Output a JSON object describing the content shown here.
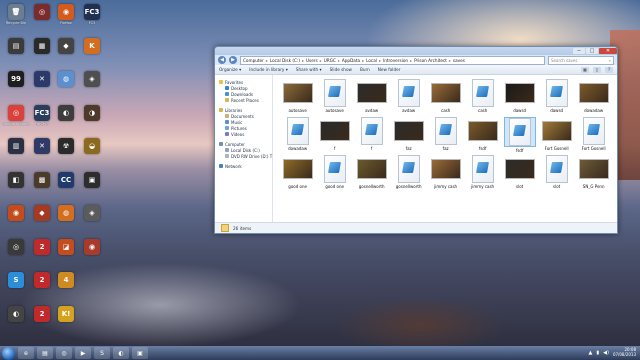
{
  "desktop": {
    "icons": [
      {
        "label": "Recycle Bin",
        "symbol": "🗑",
        "color": "#6a7d91"
      },
      {
        "label": "",
        "symbol": "◎",
        "color": "#7b2b2b"
      },
      {
        "label": "Firefox",
        "symbol": "◉",
        "color": "#d35b1d"
      },
      {
        "label": "FC3",
        "symbol": "FC3",
        "color": "#1f3050"
      },
      {
        "label": "",
        "symbol": "▤",
        "color": "#3b3b3b"
      },
      {
        "label": "",
        "symbol": "▦",
        "color": "#2a2a2a"
      },
      {
        "label": "",
        "symbol": "◆",
        "color": "#444"
      },
      {
        "label": "",
        "symbol": "K",
        "color": "#d36d1f"
      },
      {
        "label": "",
        "symbol": "99",
        "color": "#1e1e1e"
      },
      {
        "label": "",
        "symbol": "✕",
        "color": "#2c3a6b"
      },
      {
        "label": "",
        "symbol": "◍",
        "color": "#5a8fd0"
      },
      {
        "label": "",
        "symbol": "◈",
        "color": "#4f4f4f"
      },
      {
        "label": "Google Chrome",
        "symbol": "◎",
        "color": "#d9413a"
      },
      {
        "label": "FarCry3",
        "symbol": "FC3",
        "color": "#2b3d5c"
      },
      {
        "label": "",
        "symbol": "◐",
        "color": "#3d3d3d"
      },
      {
        "label": "",
        "symbol": "◑",
        "color": "#4e3a2a"
      },
      {
        "label": "",
        "symbol": "▥",
        "color": "#2c3044"
      },
      {
        "label": "",
        "symbol": "✕",
        "color": "#303a66"
      },
      {
        "label": "",
        "symbol": "☢",
        "color": "#2b2b2b"
      },
      {
        "label": "",
        "symbol": "◒",
        "color": "#8b6a1f"
      },
      {
        "label": "",
        "symbol": "◧",
        "color": "#333"
      },
      {
        "label": "",
        "symbol": "▩",
        "color": "#4a3b2b"
      },
      {
        "label": "",
        "symbol": "CC",
        "color": "#1f3a6b"
      },
      {
        "label": "",
        "symbol": "▣",
        "color": "#2d2d2d"
      },
      {
        "label": "",
        "symbol": "◉",
        "color": "#c34b1c"
      },
      {
        "label": "",
        "symbol": "◆",
        "color": "#a53a22"
      },
      {
        "label": "",
        "symbol": "◍",
        "color": "#d36d1f"
      },
      {
        "label": "",
        "symbol": "◈",
        "color": "#5b5b5b"
      },
      {
        "label": "",
        "symbol": "◎",
        "color": "#3a3a3a"
      },
      {
        "label": "",
        "symbol": "2",
        "color": "#c02a2a"
      },
      {
        "label": "",
        "symbol": "◪",
        "color": "#c34d1f"
      },
      {
        "label": "",
        "symbol": "◉",
        "color": "#a93b2b"
      },
      {
        "label": "",
        "symbol": "S",
        "color": "#2a8fd8"
      },
      {
        "label": "",
        "symbol": "2",
        "color": "#c02a2a"
      },
      {
        "label": "",
        "symbol": "4",
        "color": "#d08a22"
      },
      {
        "label": "",
        "symbol": "",
        "color": "#000000"
      },
      {
        "label": "",
        "symbol": "◐",
        "color": "#444"
      },
      {
        "label": "",
        "symbol": "2",
        "color": "#c02a2a"
      },
      {
        "label": "",
        "symbol": "K!",
        "color": "#d3a21f"
      },
      {
        "label": "",
        "symbol": "",
        "color": "#000000"
      }
    ]
  },
  "window": {
    "controls": {
      "minimize": "─",
      "maximize": "□",
      "close": "✕"
    },
    "address": [
      "Computer",
      "Local Disk (C:)",
      "Users",
      "URGC",
      "AppData",
      "Local",
      "Introversion",
      "Prison Architect",
      "saves"
    ],
    "search_placeholder": "Search saves",
    "toolbar": [
      "Organize ▾",
      "Include in library ▾",
      "Share with ▾",
      "Slide show",
      "Burn",
      "New folder"
    ],
    "nav": {
      "favorites": {
        "title": "Favorites",
        "items": [
          "Desktop",
          "Downloads",
          "Recent Places"
        ]
      },
      "libraries": {
        "title": "Libraries",
        "items": [
          "Documents",
          "Music",
          "Pictures",
          "Videos"
        ]
      },
      "computer": {
        "title": "Computer",
        "items": [
          "Local Disk (C:)",
          "DVD RW Drive (D:) T"
        ]
      },
      "network": {
        "title": "Network"
      }
    },
    "files": [
      {
        "name": "autosave",
        "kind": "img",
        "color": "#8a6a3a"
      },
      {
        "name": "autosave",
        "kind": "doc"
      },
      {
        "name": "avdaw",
        "kind": "img",
        "color": "#2b2b2b"
      },
      {
        "name": "avdaw",
        "kind": "doc"
      },
      {
        "name": "cash",
        "kind": "img",
        "color": "#9a6b3a"
      },
      {
        "name": "cash",
        "kind": "doc"
      },
      {
        "name": "dawsd",
        "kind": "img",
        "color": "#1a1a1a"
      },
      {
        "name": "dawsd",
        "kind": "doc"
      },
      {
        "name": "dowadaw",
        "kind": "img",
        "color": "#7b5a2e"
      },
      {
        "name": "dowadaw",
        "kind": "doc"
      },
      {
        "name": "f",
        "kind": "img",
        "color": "#2a2a2a"
      },
      {
        "name": "f",
        "kind": "doc"
      },
      {
        "name": "faz",
        "kind": "img",
        "color": "#2b2b2b"
      },
      {
        "name": "faz",
        "kind": "doc"
      },
      {
        "name": "fsdf",
        "kind": "img",
        "color": "#7a5a2a"
      },
      {
        "name": "fsdf",
        "kind": "doc",
        "selected": true
      },
      {
        "name": "Fort Gosnell",
        "kind": "img",
        "color": "#a07a3a"
      },
      {
        "name": "Fort Gosnell",
        "kind": "doc"
      },
      {
        "name": "good one",
        "kind": "img",
        "color": "#8f6b2a"
      },
      {
        "name": "good one",
        "kind": "doc"
      },
      {
        "name": "gosnellworth",
        "kind": "img",
        "color": "#6b5a2e"
      },
      {
        "name": "gosnellworth",
        "kind": "doc"
      },
      {
        "name": "jimmy cash",
        "kind": "img",
        "color": "#9a6b3a"
      },
      {
        "name": "jimmy cash",
        "kind": "doc"
      },
      {
        "name": "slot",
        "kind": "img",
        "color": "#2b2b2b"
      },
      {
        "name": "slot",
        "kind": "doc"
      },
      {
        "name": "SN_G Penn",
        "kind": "img",
        "color": "#6b5a3a"
      }
    ],
    "status": "26 items"
  },
  "taskbar": {
    "buttons": [
      {
        "name": "ie-button",
        "symbol": "e"
      },
      {
        "name": "explorer-button",
        "symbol": "▤"
      },
      {
        "name": "chrome-button",
        "symbol": "◎"
      },
      {
        "name": "media-button",
        "symbol": "▶"
      },
      {
        "name": "skype-button",
        "symbol": "S"
      },
      {
        "name": "steam-button",
        "symbol": "◐"
      },
      {
        "name": "game-button",
        "symbol": "▣"
      }
    ],
    "time": "20:08",
    "date": "07/08/2013"
  }
}
